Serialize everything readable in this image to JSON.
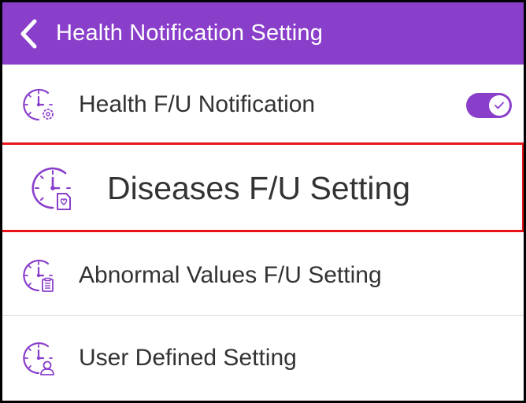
{
  "header": {
    "title": "Health Notification Setting",
    "back_icon": "chevron-left-icon",
    "background_color": "#8a3fcb"
  },
  "settings": {
    "items": [
      {
        "label": "Health F/U Notification",
        "icon": "clock-gear-icon",
        "toggle_on": true
      },
      {
        "label": "Diseases F/U Setting",
        "icon": "clock-heart-document-icon",
        "highlighted": true,
        "highlight_color": "#e8141a"
      },
      {
        "label": "Abnormal Values F/U Setting",
        "icon": "clock-clipboard-icon"
      },
      {
        "label": "User Defined Setting",
        "icon": "clock-user-icon"
      }
    ]
  },
  "accent_color": "#8a3fcb"
}
